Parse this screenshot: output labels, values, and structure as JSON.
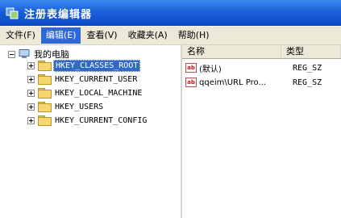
{
  "window": {
    "title": "注册表编辑器"
  },
  "menu": [
    {
      "label": "文件(F)"
    },
    {
      "label": "编辑(E)"
    },
    {
      "label": "查看(V)"
    },
    {
      "label": "收藏夹(A)"
    },
    {
      "label": "帮助(H)"
    }
  ],
  "tree": {
    "root_label": "我的电脑",
    "keys": [
      {
        "label": "HKEY_CLASSES_ROOT",
        "selected": true
      },
      {
        "label": "HKEY_CURRENT_USER"
      },
      {
        "label": "HKEY_LOCAL_MACHINE"
      },
      {
        "label": "HKEY_USERS"
      },
      {
        "label": "HKEY_CURRENT_CONFIG"
      }
    ]
  },
  "list": {
    "columns": [
      "名称",
      "类型"
    ],
    "rows": [
      {
        "icon": "ab",
        "name": "(默认)",
        "type": "REG_SZ"
      },
      {
        "icon": "ab",
        "name": "qqeim\\URL Pro...",
        "type": "REG_SZ"
      }
    ]
  }
}
